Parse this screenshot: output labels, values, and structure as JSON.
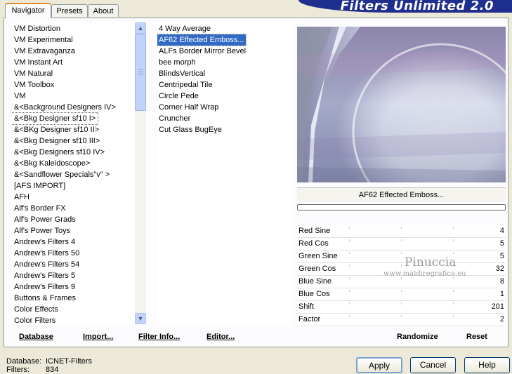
{
  "tabs": [
    "Navigator",
    "Presets",
    "About"
  ],
  "brand": "Filters Unlimited 2.0",
  "categories": [
    "VM Distortion",
    "VM Experimental",
    "VM Extravaganza",
    "VM Instant Art",
    "VM Natural",
    "VM Toolbox",
    "VM",
    "&<Background Designers IV>",
    "&<Bkg Designer sf10 I>",
    "&<BKg Designer sf10 II>",
    "&<Bkg Designer sf10 III>",
    "&<Bkg Designers sf10 IV>",
    "&<Bkg Kaleidoscope>",
    "&<Sandflower Specials\"v\" >",
    "[AFS IMPORT]",
    "AFH",
    "Alf's Border FX",
    "Alf's Power Grads",
    "Alf's Power Toys",
    "Andrew's Filters 4",
    "Andrew's Filters 50",
    "Andrew's Filters 54",
    "Andrew's Filters 5",
    "Andrew's Filters 9",
    "Buttons & Frames",
    "Color Effects",
    "Color Filters"
  ],
  "filters": [
    "4 Way Average",
    "AF62 Effected Emboss...",
    "ALFs Border Mirror Bevel",
    "bee morph",
    "BlindsVertical",
    "Centripedal Tile",
    "Circle Pede",
    "Corner Half Wrap",
    "Cruncher",
    "Cut Glass  BugEye"
  ],
  "selected_filter": "AF62 Effected Emboss...",
  "params": [
    {
      "name": "Red Sine",
      "value": "4"
    },
    {
      "name": "Red Cos",
      "value": "5"
    },
    {
      "name": "Green Sine",
      "value": "5"
    },
    {
      "name": "Green Cos",
      "value": "32"
    },
    {
      "name": "Blue Sine",
      "value": "8"
    },
    {
      "name": "Blue Cos",
      "value": "1"
    },
    {
      "name": "Shift",
      "value": "201"
    },
    {
      "name": "Factor",
      "value": "2"
    }
  ],
  "watermark": {
    "name": "Pinuccia",
    "site": "www.maidiregrafica.eu"
  },
  "links": {
    "database": "Database",
    "import": "Import...",
    "filter_info": "Filter Info...",
    "editor": "Editor..."
  },
  "actions": {
    "randomize": "Randomize",
    "reset": "Reset"
  },
  "buttons": {
    "apply": "Apply",
    "cancel": "Cancel",
    "help": "Help"
  },
  "info": {
    "database_label": "Database:",
    "database_value": "ICNET-Filters",
    "filters_label": "Filters:",
    "filters_value": "834"
  }
}
